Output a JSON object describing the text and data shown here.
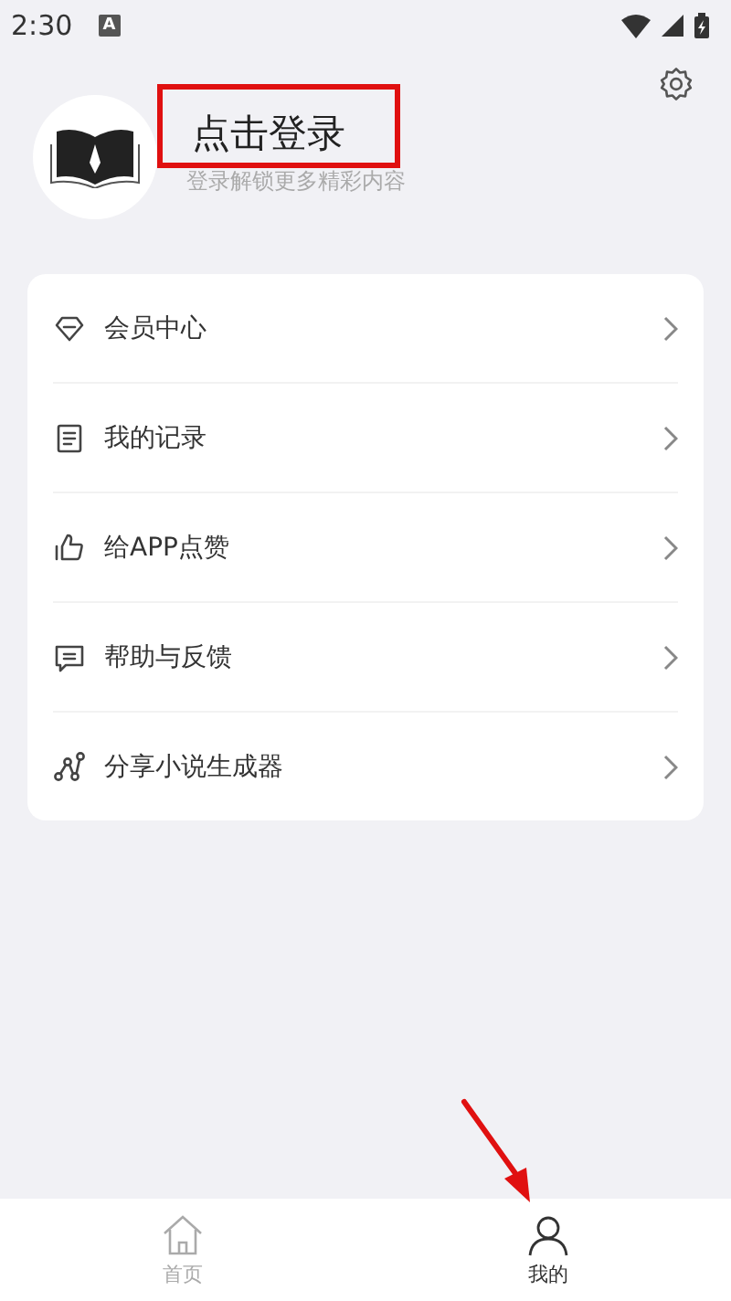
{
  "status_bar": {
    "time": "2:30",
    "notification": "A"
  },
  "profile": {
    "title": "点击登录",
    "subtitle": "登录解锁更多精彩内容"
  },
  "menu": [
    {
      "label": "会员中心"
    },
    {
      "label": "我的记录"
    },
    {
      "label": "给APP点赞"
    },
    {
      "label": "帮助与反馈"
    },
    {
      "label": "分享小说生成器"
    }
  ],
  "tab_bar": [
    {
      "label": "首页",
      "selected": false
    },
    {
      "label": "我的",
      "selected": true
    }
  ]
}
